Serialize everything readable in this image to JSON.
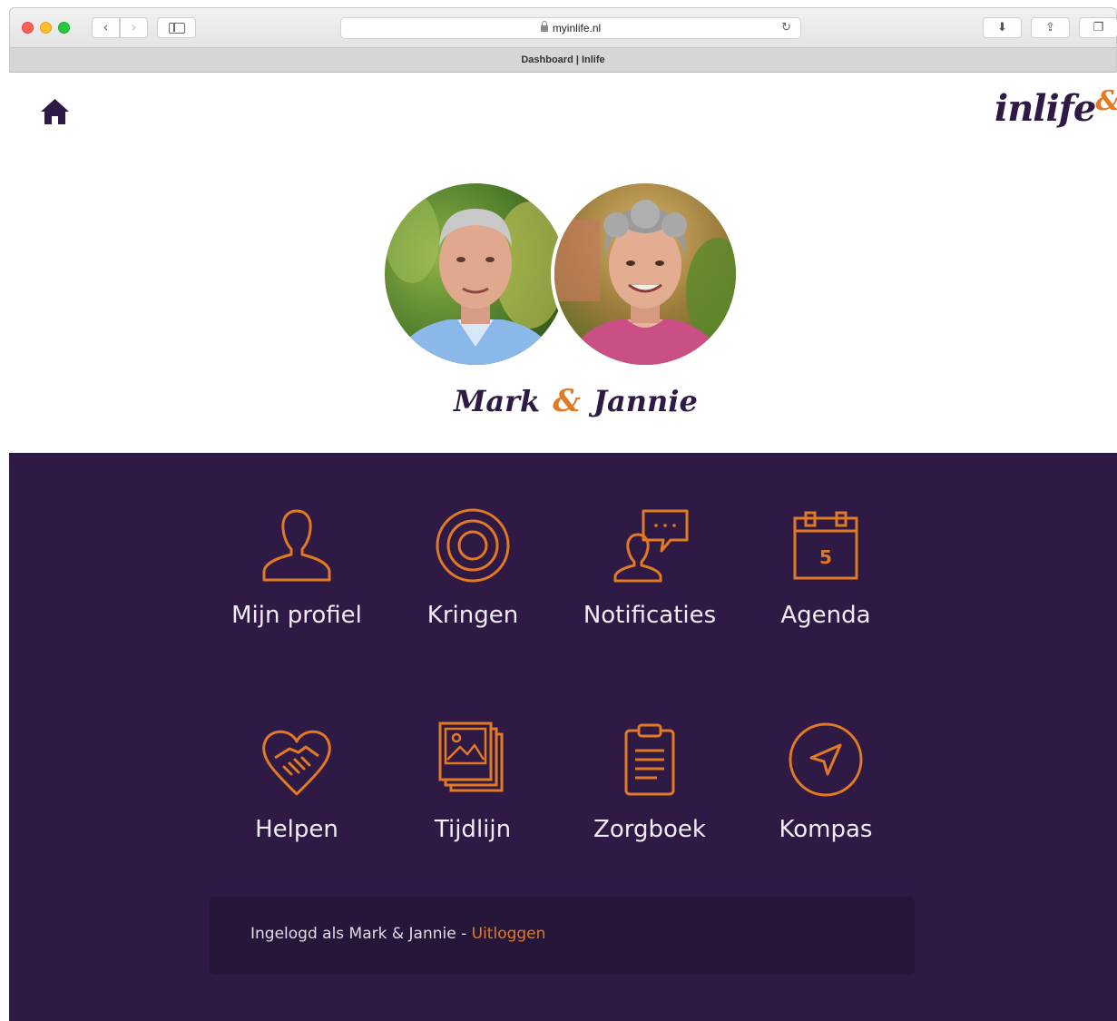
{
  "browser": {
    "url": "myinlife.nl",
    "tab_title": "Dashboard | Inlife"
  },
  "header": {
    "logo_text": "inlife",
    "logo_amp": "&"
  },
  "profile": {
    "name_1": "Mark",
    "amp": "&",
    "name_2": "Jannie"
  },
  "tiles": [
    {
      "label": "Mijn profiel",
      "icon": "user-icon"
    },
    {
      "label": "Kringen",
      "icon": "circles-icon"
    },
    {
      "label": "Notificaties",
      "icon": "notification-icon"
    },
    {
      "label": "Agenda",
      "icon": "calendar-icon",
      "badge": "5"
    },
    {
      "label": "Helpen",
      "icon": "handshake-heart-icon"
    },
    {
      "label": "Tijdlijn",
      "icon": "photo-stack-icon"
    },
    {
      "label": "Zorgboek",
      "icon": "clipboard-icon"
    },
    {
      "label": "Kompas",
      "icon": "compass-icon"
    }
  ],
  "footer": {
    "logged_in_text": "Ingelogd als Mark & Jannie - ",
    "logout_label": "Uitloggen"
  },
  "colors": {
    "brand_purple": "#2f1a45",
    "accent_orange": "#e07a25"
  }
}
